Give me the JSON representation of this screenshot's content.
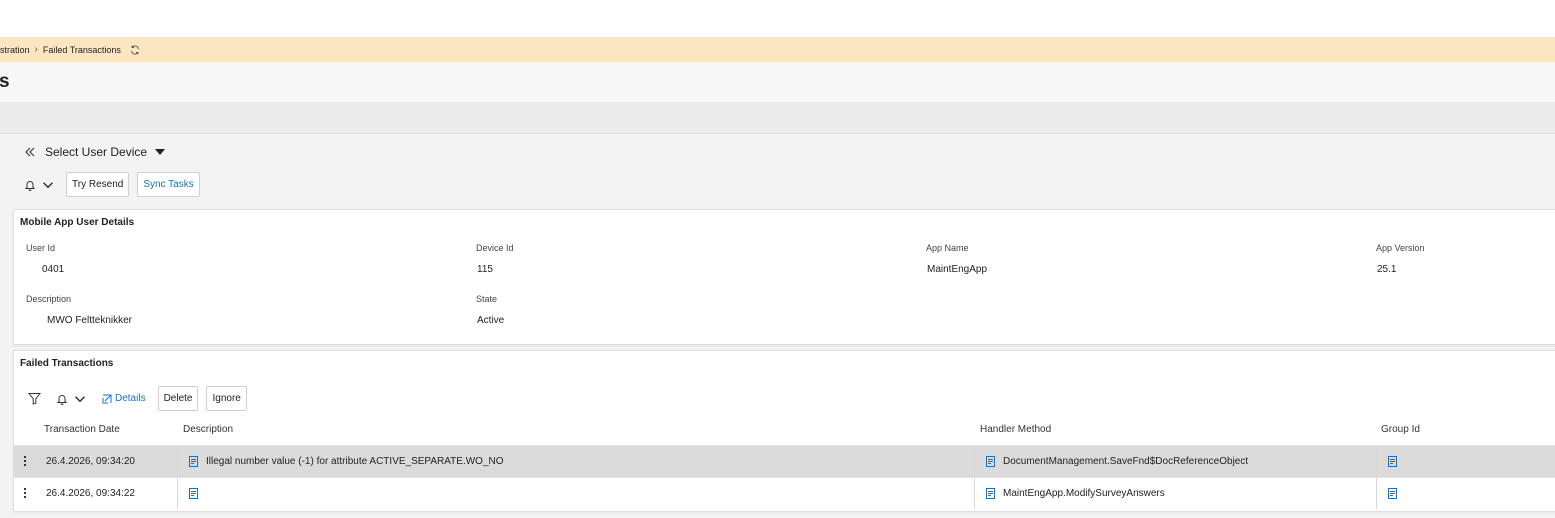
{
  "breadcrumb": {
    "items": [
      "istration",
      "Failed Transactions"
    ],
    "separator": "›"
  },
  "page": {
    "title": "s"
  },
  "device_selector": {
    "label": "Select User Device"
  },
  "toolbar": {
    "try_resend": "Try Resend",
    "sync_tasks": "Sync Tasks"
  },
  "user_details": {
    "title": "Mobile App User Details",
    "fields": [
      {
        "label": "User Id",
        "value": "0401"
      },
      {
        "label": "Device Id",
        "value": "115"
      },
      {
        "label": "App Name",
        "value": "MaintEngApp"
      },
      {
        "label": "App Version",
        "value": "25.1"
      },
      {
        "label": "Description",
        "value": "MWO Feltteknikker"
      },
      {
        "label": "State",
        "value": "Active"
      }
    ]
  },
  "failed_transactions": {
    "title": "Failed Transactions",
    "details_label": "Details",
    "delete_label": "Delete",
    "ignore_label": "Ignore",
    "columns": [
      "Transaction Date",
      "Description",
      "Handler Method",
      "Group Id"
    ],
    "rows": [
      {
        "date": "26.4.2026, 09:34:20",
        "description": "Illegal number value (-1) for attribute ACTIVE_SEPARATE.WO_NO",
        "handler": "DocumentManagement.SaveFnd$DocReferenceObject",
        "selected": true
      },
      {
        "date": "26.4.2026, 09:34:22",
        "description": "",
        "handler": "MaintEngApp.ModifySurveyAnswers",
        "selected": false
      }
    ]
  },
  "colors": {
    "breadcrumb_bg": "#fbe6c0",
    "link": "#1f6fb5",
    "selected_row": "#dbdbdb"
  },
  "icons": [
    "refresh-icon",
    "collapse-icon",
    "caret-down-icon",
    "bell-icon",
    "chevron-down-icon",
    "filter-icon",
    "open-details-icon",
    "kebab-icon",
    "document-icon"
  ]
}
